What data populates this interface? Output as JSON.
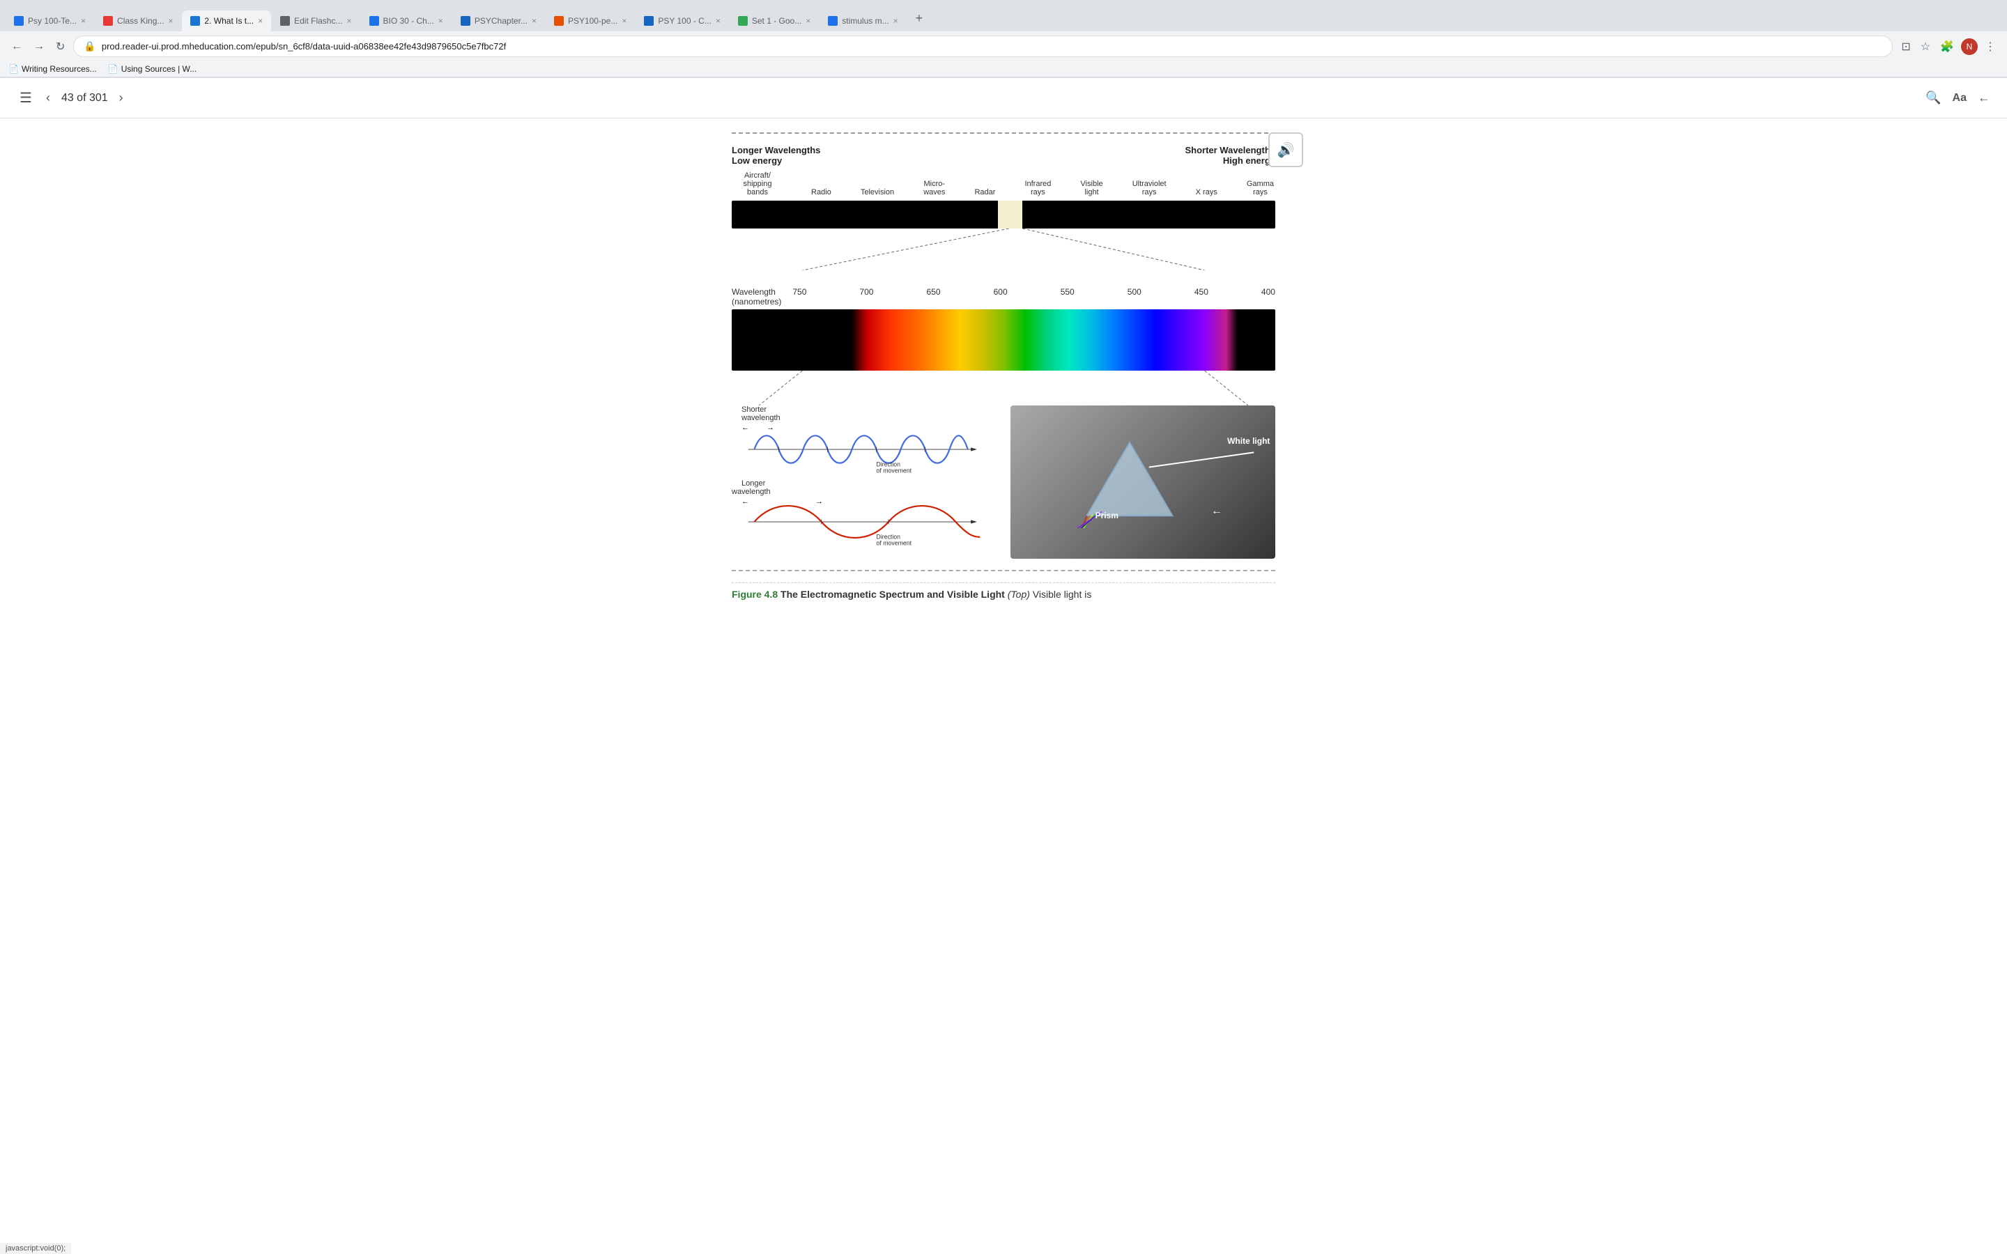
{
  "browser": {
    "tabs": [
      {
        "id": "tab-psy100",
        "label": "Psy 100-Te...",
        "favicon_color": "#1a73e8",
        "active": false
      },
      {
        "id": "tab-classking",
        "label": "Class King...",
        "favicon_color": "#e53935",
        "active": false
      },
      {
        "id": "tab-whatist",
        "label": "2. What Is t...",
        "favicon_color": "#1976d2",
        "active": true
      },
      {
        "id": "tab-editflash",
        "label": "Edit Flashc...",
        "favicon_color": "#5f6368",
        "active": false
      },
      {
        "id": "tab-bio30",
        "label": "BIO 30 - Ch...",
        "favicon_color": "#1a73e8",
        "active": false
      },
      {
        "id": "tab-psychapter",
        "label": "PSYChapter...",
        "favicon_color": "#1565c0",
        "active": false
      },
      {
        "id": "tab-psy100pe",
        "label": "PSY100-pe...",
        "favicon_color": "#e65100",
        "active": false
      },
      {
        "id": "tab-psy100c",
        "label": "PSY 100 - C...",
        "favicon_color": "#1565c0",
        "active": false
      },
      {
        "id": "tab-set1",
        "label": "Set 1 - Goo...",
        "favicon_color": "#34a853",
        "active": false
      },
      {
        "id": "tab-stimulus",
        "label": "stimulus m...",
        "favicon_color": "#1a73e8",
        "active": false
      }
    ],
    "url": "prod.reader-ui.prod.mheducation.com/epub/sn_6cf8/data-uuid-a06838ee42fe43d9879650c5e7fbc72f",
    "bookmarks": [
      {
        "label": "Writing Resources..."
      },
      {
        "label": "Using Sources | W..."
      }
    ]
  },
  "reader": {
    "toc_label": "☰",
    "prev_label": "‹",
    "next_label": "›",
    "page_indicator": "43 of 301",
    "search_label": "🔍",
    "font_label": "Aa",
    "back_label": "←"
  },
  "figure": {
    "header_left_line1": "Longer Wavelengths",
    "header_left_line2": "Low energy",
    "header_right_line1": "Shorter Wavelengths",
    "header_right_line2": "High energy",
    "spectrum_labels": [
      {
        "label": "Aircraft/\nshipping\nbands"
      },
      {
        "label": "Radio"
      },
      {
        "label": "Television"
      },
      {
        "label": "Micro-\nwaves"
      },
      {
        "label": "Radar"
      },
      {
        "label": "Infrared\nrays"
      },
      {
        "label": "Visible\nlight"
      },
      {
        "label": "Ultraviolet\nrays"
      },
      {
        "label": "X rays"
      },
      {
        "label": "Gamma\nrays"
      }
    ],
    "wavelength_title": "Wavelength\n(nanometres)",
    "wavelength_numbers": [
      "750",
      "700",
      "650",
      "600",
      "550",
      "500",
      "450",
      "400"
    ],
    "shorter_wavelength_label": "Shorter\nwavelength",
    "longer_wavelength_label": "Longer\nwavelength",
    "direction_label1": "Direction\nof movement",
    "direction_label2": "Direction\nof movement",
    "white_light_label": "White light",
    "prism_label": "Prism",
    "caption_label": "Figure 4.8",
    "caption_bold": "The Electromagnetic Spectrum and Visible Light",
    "caption_italic": "(Top)",
    "caption_text": "Visible light is"
  }
}
